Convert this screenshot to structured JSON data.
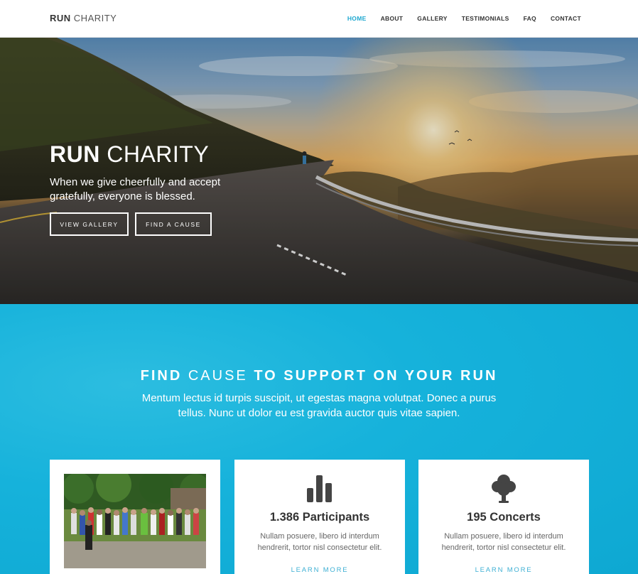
{
  "nav": {
    "logo_bold": "RUN",
    "logo_light": "CHARITY",
    "items": [
      {
        "label": "HOME",
        "active": true
      },
      {
        "label": "ABOUT",
        "active": false
      },
      {
        "label": "GALLERY",
        "active": false
      },
      {
        "label": "TESTIMONIALS",
        "active": false
      },
      {
        "label": "FAQ",
        "active": false
      },
      {
        "label": "CONTACT",
        "active": false
      }
    ]
  },
  "hero": {
    "title_bold": "RUN",
    "title_light": "CHARITY",
    "subtitle": "When we give cheerfully and accept gratefully, everyone is blessed.",
    "buttons": [
      "VIEW GALLERY",
      "FIND A CAUSE"
    ]
  },
  "cause": {
    "title_part1": "FIND",
    "title_part2": "CAUSE",
    "title_part3": "TO SUPPORT ON YOUR RUN",
    "text": "Mentum lectus id turpis suscipit, ut egestas magna volutpat. Donec a purus tellus. Nunc ut dolor eu est gravida auctor quis vitae sapien.",
    "cards": [
      {
        "type": "photo"
      },
      {
        "icon": "bar-chart-icon",
        "heading": "1.386 Participants",
        "desc": "Nullam posuere, libero id interdum hendrerit, tortor nisl consectetur elit.",
        "link": "LEARN MORE"
      },
      {
        "icon": "tree-icon",
        "heading": "195 Concerts",
        "desc": "Nullam posuere, libero id interdum hendrerit, tortor nisl consectetur elit.",
        "link": "LEARN MORE"
      }
    ]
  },
  "colors": {
    "accent": "#1fa8d0",
    "section_bg": "#16b2db",
    "text_dark": "#333333"
  }
}
